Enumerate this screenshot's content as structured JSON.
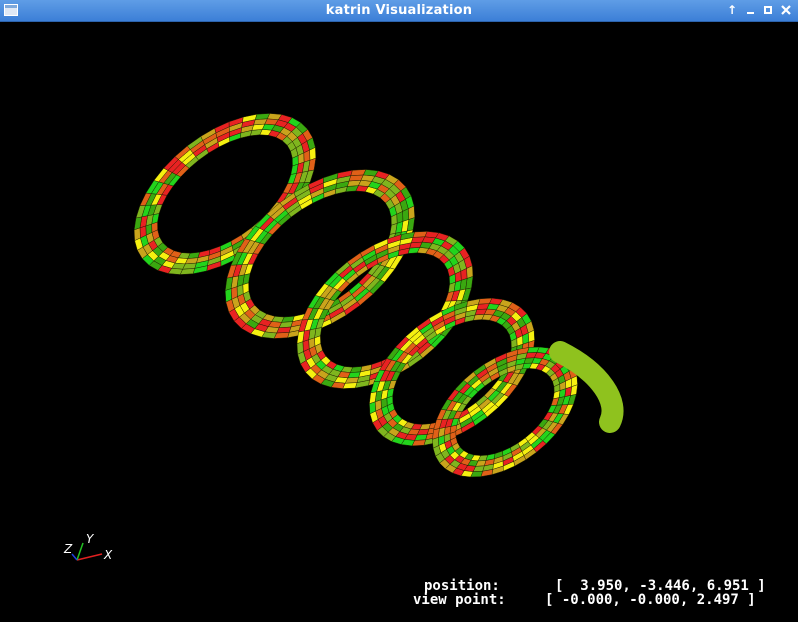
{
  "window": {
    "title": "katrin Visualization",
    "buttons": {
      "shade": "↑"
    }
  },
  "scene": {
    "object": "helix",
    "tile_colors": [
      "#e82222",
      "#e06018",
      "#c9a41c",
      "#7fb51e",
      "#22d41c",
      "#f5f010",
      "#3aa810"
    ]
  },
  "axes": {
    "x": "X",
    "y": "Y",
    "z": "Z"
  },
  "hud": {
    "position_label": "position:",
    "position_value": "[  3.950, -3.446, 6.951 ]",
    "viewpoint_label": "view point:",
    "viewpoint_value": "[ -0.000, -0.000, 2.497 ]"
  }
}
